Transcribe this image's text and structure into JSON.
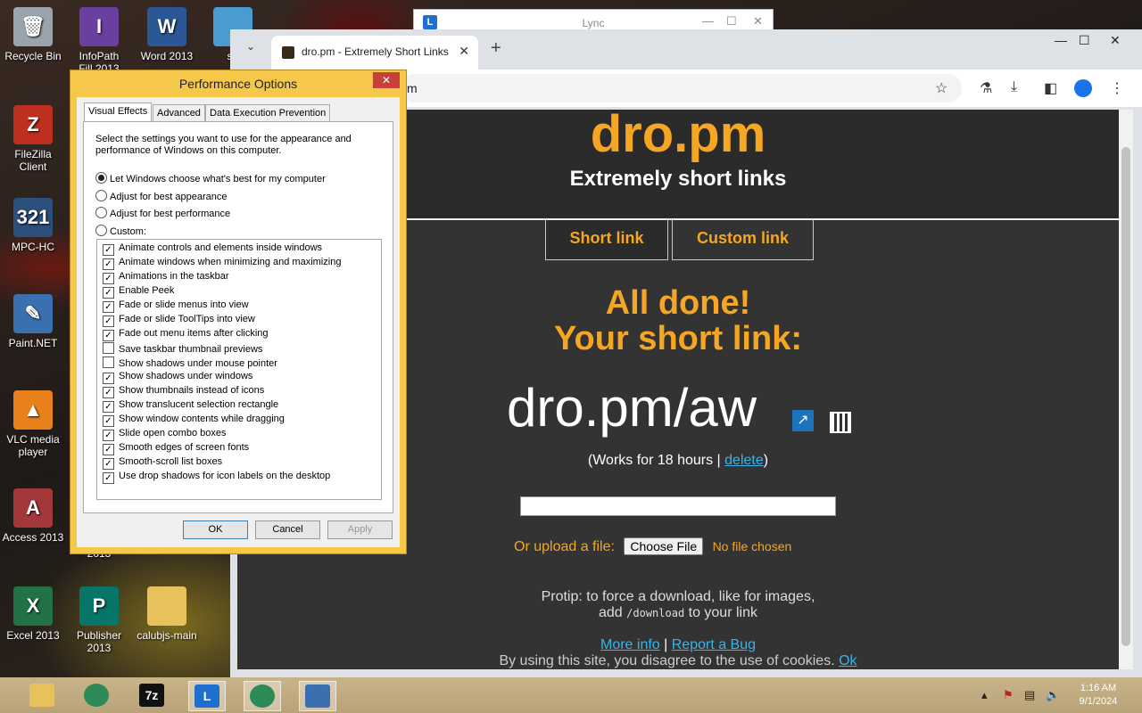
{
  "desktop": {
    "icons": [
      {
        "label": "Recycle Bin",
        "icon": "recycle-bin-icon",
        "color": "#9aa4ad",
        "glyph": "🗑"
      },
      {
        "label": "InfoPath\nFill 2013",
        "icon": "infopath-icon",
        "color": "#6b3fa0",
        "glyph": "I"
      },
      {
        "label": "Word 2013",
        "icon": "word-icon",
        "color": "#2b5797",
        "glyph": "W"
      },
      {
        "label": "sn",
        "icon": "app-icon",
        "color": "#4a9bd0",
        "glyph": ""
      },
      {
        "label": "FileZilla\nClient",
        "icon": "filezilla-icon",
        "color": "#bf2f1f",
        "glyph": "Z"
      },
      {
        "label": "MPC-HC",
        "icon": "mpc-hc-icon",
        "color": "#2c4f7c",
        "glyph": "321"
      },
      {
        "label": "Paint.NET",
        "icon": "paint-net-icon",
        "color": "#3a6fb0",
        "glyph": "✎"
      },
      {
        "label": "VLC media\nplayer",
        "icon": "vlc-icon",
        "color": "#e8811a",
        "glyph": "▲"
      },
      {
        "label": "Access 2013",
        "icon": "access-icon",
        "color": "#a4373a",
        "glyph": "A"
      },
      {
        "label": "Excel 2013",
        "icon": "excel-icon",
        "color": "#217346",
        "glyph": "X"
      },
      {
        "label": "Publisher\n2013",
        "icon": "publisher-icon",
        "color": "#077568",
        "glyph": "P"
      },
      {
        "label": "calubjs-main",
        "icon": "folder-icon",
        "color": "#e8c15a",
        "glyph": ""
      }
    ],
    "partial_label_2013": "2013"
  },
  "lync": {
    "title": "Lync",
    "logo": "L"
  },
  "browser": {
    "tab_title": "dro.pm - Extremely Short Links",
    "url_tail": "m",
    "site": {
      "title": "dro.pm",
      "subtitle": "Extremely short links",
      "tabs": [
        "Short link",
        "Custom link"
      ],
      "done_line1": "All done!",
      "done_line2": "Your short link:",
      "short_link": "dro.pm/aw",
      "works_prefix": "(Works for 18 hours | ",
      "delete": "delete",
      "works_suffix": ")",
      "upload_label": "Or upload a file:",
      "choose_file": "Choose File",
      "no_file": "No file chosen",
      "protip_line1": "Protip: to force a download, like for images,",
      "protip_add": "add ",
      "protip_code": "/download",
      "protip_tail": " to your link",
      "more_info": "More info",
      "separator": " | ",
      "report_bug": "Report a Bug",
      "cookie_text": "By using this site, you disagree to the use of cookies. ",
      "cookie_ok": "Ok"
    }
  },
  "dialog": {
    "title": "Performance Options",
    "tabs": [
      "Visual Effects",
      "Advanced",
      "Data Execution Prevention"
    ],
    "description": "Select the settings you want to use for the appearance and performance of Windows on this computer.",
    "radios": [
      {
        "label": "Let Windows choose what's best for my computer",
        "selected": true
      },
      {
        "label": "Adjust for best appearance",
        "selected": false
      },
      {
        "label": "Adjust for best performance",
        "selected": false
      },
      {
        "label": "Custom:",
        "selected": false
      }
    ],
    "options": [
      {
        "label": "Animate controls and elements inside windows",
        "checked": true
      },
      {
        "label": "Animate windows when minimizing and maximizing",
        "checked": true
      },
      {
        "label": "Animations in the taskbar",
        "checked": true
      },
      {
        "label": "Enable Peek",
        "checked": true
      },
      {
        "label": "Fade or slide menus into view",
        "checked": true
      },
      {
        "label": "Fade or slide ToolTips into view",
        "checked": true
      },
      {
        "label": "Fade out menu items after clicking",
        "checked": true
      },
      {
        "label": "Save taskbar thumbnail previews",
        "checked": false
      },
      {
        "label": "Show shadows under mouse pointer",
        "checked": false
      },
      {
        "label": "Show shadows under windows",
        "checked": true
      },
      {
        "label": "Show thumbnails instead of icons",
        "checked": true
      },
      {
        "label": "Show translucent selection rectangle",
        "checked": true
      },
      {
        "label": "Show window contents while dragging",
        "checked": true
      },
      {
        "label": "Slide open combo boxes",
        "checked": true
      },
      {
        "label": "Smooth edges of screen fonts",
        "checked": true
      },
      {
        "label": "Smooth-scroll list boxes",
        "checked": true
      },
      {
        "label": "Use drop shadows for icon labels on the desktop",
        "checked": true
      }
    ],
    "ok": "OK",
    "cancel": "Cancel",
    "apply": "Apply"
  },
  "taskbar": {
    "items": [
      {
        "name": "file-explorer-icon",
        "color": "#e8c15a",
        "glyph": "",
        "active": false
      },
      {
        "name": "browser-globe-icon",
        "color": "#2e8b57",
        "glyph": "",
        "active": false
      },
      {
        "name": "7zip-icon",
        "color": "#111111",
        "glyph": "7z",
        "active": false
      },
      {
        "name": "lync-icon",
        "color": "#1f6fd0",
        "glyph": "L",
        "active": true
      },
      {
        "name": "browser-globe-icon-2",
        "color": "#2e8b57",
        "glyph": "",
        "active": true
      },
      {
        "name": "performance-monitor-icon",
        "color": "#3a6fb0",
        "glyph": "",
        "active": true
      }
    ],
    "time": "1:16 AM",
    "date": "9/1/2024"
  }
}
